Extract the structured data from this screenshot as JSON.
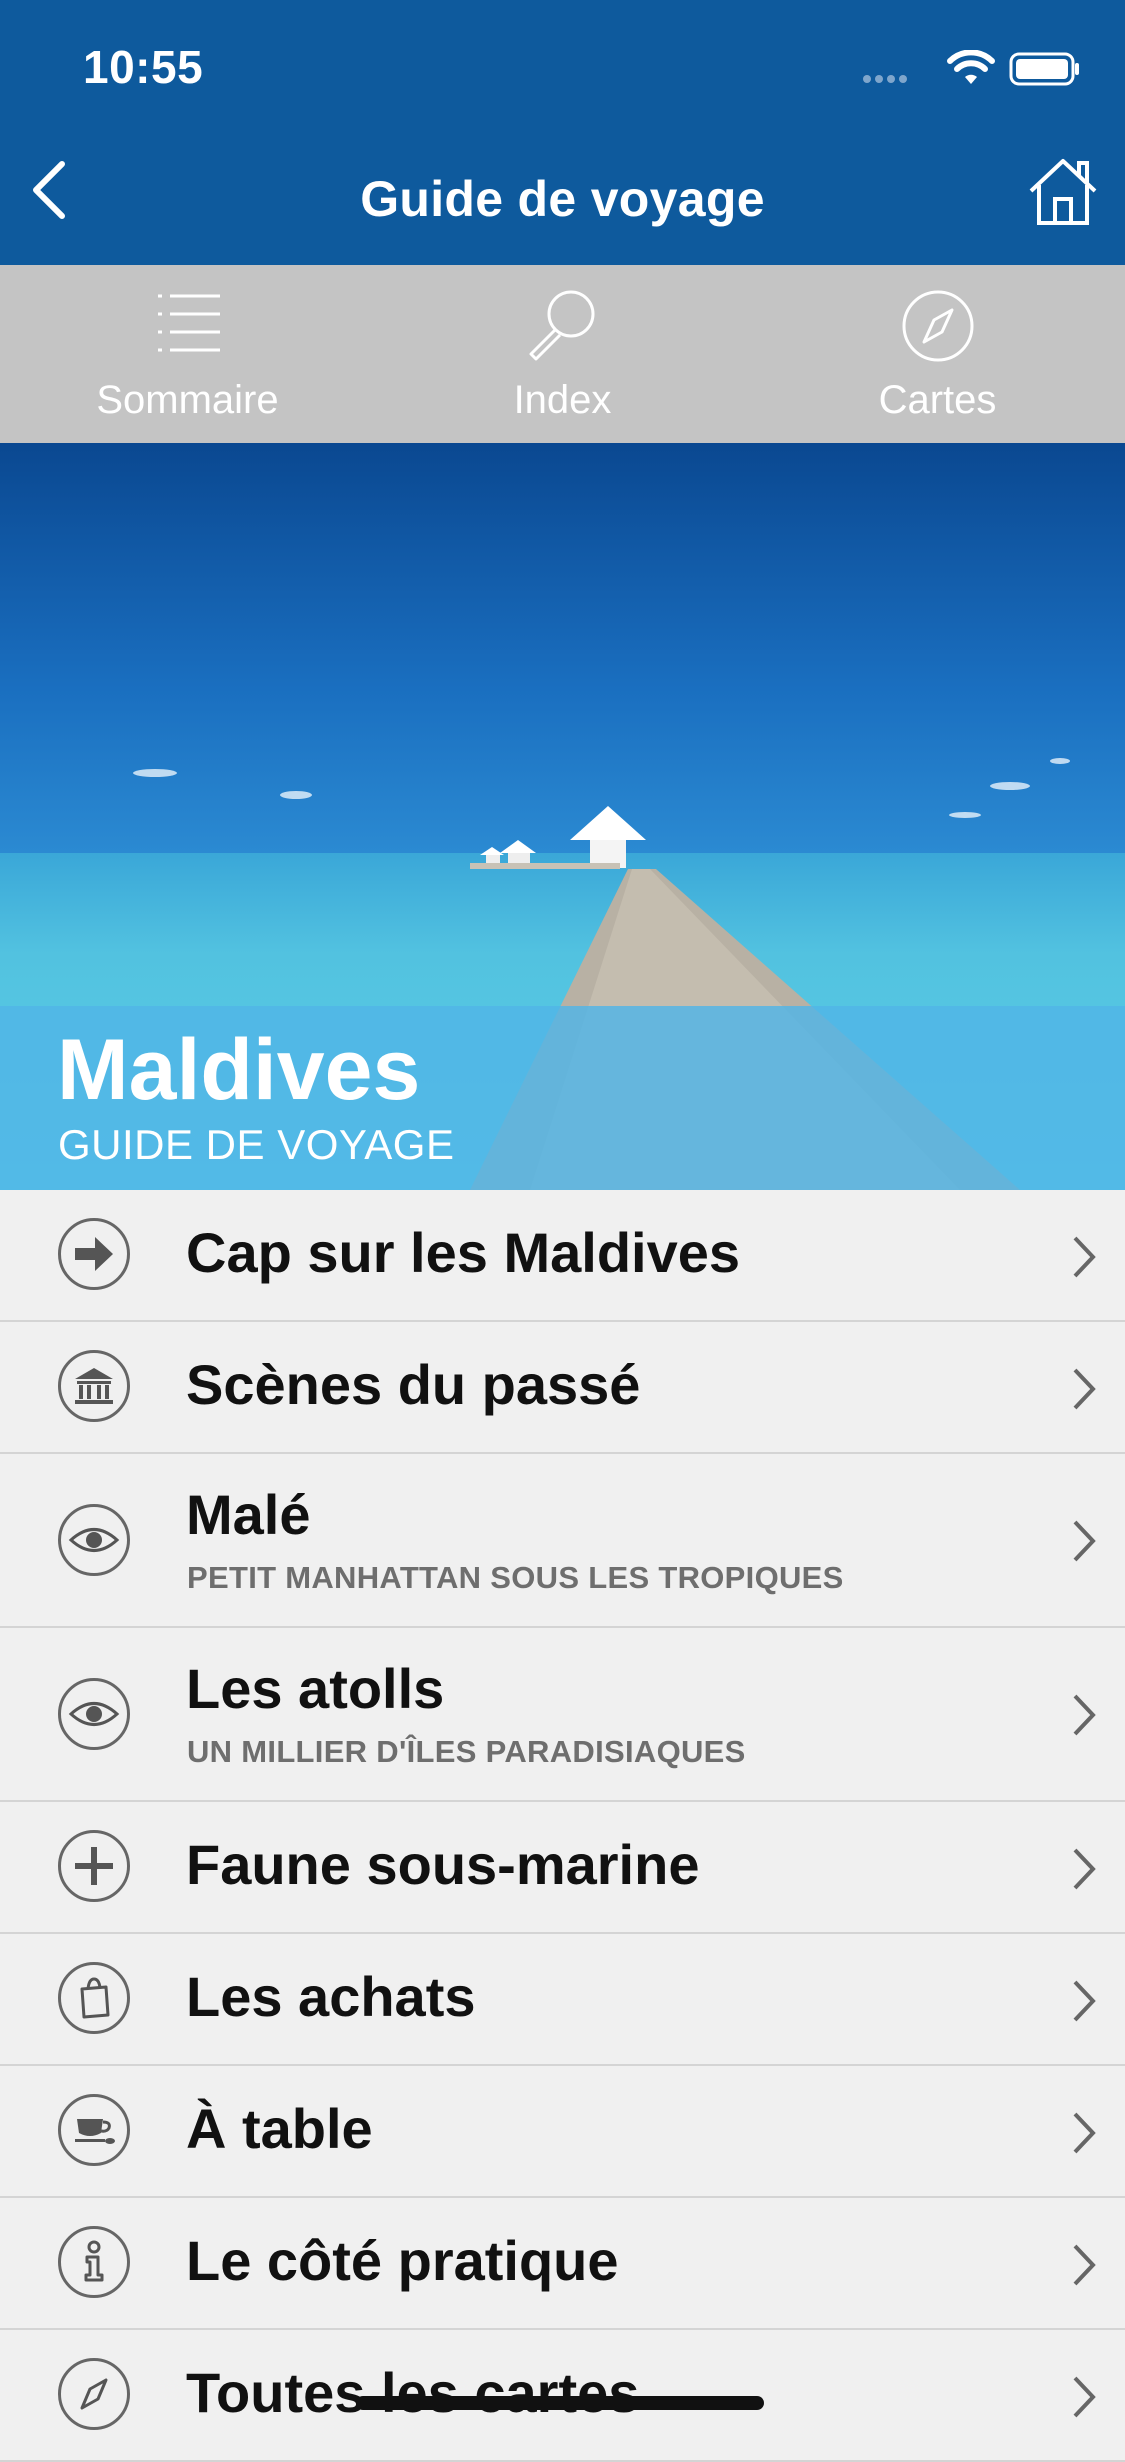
{
  "status_bar": {
    "time": "10:55"
  },
  "nav": {
    "title": "Guide de voyage"
  },
  "toolbar": [
    {
      "label": "Sommaire",
      "icon": "list-icon"
    },
    {
      "label": "Index",
      "icon": "search-icon"
    },
    {
      "label": "Cartes",
      "icon": "compass-icon"
    }
  ],
  "hero": {
    "title": "Maldives",
    "subtitle": "GUIDE DE VOYAGE"
  },
  "menu": [
    {
      "title": "Cap sur les Maldives",
      "subtitle": "",
      "icon": "arrow-right-icon"
    },
    {
      "title": "Scènes du passé",
      "subtitle": "",
      "icon": "museum-icon"
    },
    {
      "title": "Malé",
      "subtitle": "PETIT MANHATTAN SOUS LES TROPIQUES",
      "icon": "eye-icon"
    },
    {
      "title": "Les atolls",
      "subtitle": "UN MILLIER D'ÎLES PARADISIAQUES",
      "icon": "eye-icon"
    },
    {
      "title": "Faune sous-marine",
      "subtitle": "",
      "icon": "plus-icon"
    },
    {
      "title": "Les achats",
      "subtitle": "",
      "icon": "shopping-bag-icon"
    },
    {
      "title": "À table",
      "subtitle": "",
      "icon": "coffee-cup-icon"
    },
    {
      "title": "Le côté pratique",
      "subtitle": "",
      "icon": "info-icon"
    },
    {
      "title": "Toutes les cartes",
      "subtitle": "",
      "icon": "compass-icon"
    }
  ],
  "colors": {
    "header": "#0e5a9d",
    "toolstrip": "#c4c4c4",
    "list_bg": "#f0f0f0"
  }
}
